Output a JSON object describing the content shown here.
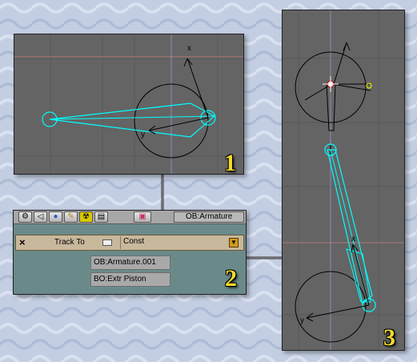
{
  "viewport1": {
    "label": "1",
    "axis_x": "x",
    "axis_y": "y"
  },
  "viewport3": {
    "label": "3",
    "axis_x": "x",
    "axis_y": "y"
  },
  "constraint_panel": {
    "label": "2",
    "object_name": "OB:Armature",
    "constraint_type": "Track To",
    "constraint_name": "Const",
    "close_glyph": "×",
    "target_object": "OB:Armature.001",
    "target_bone": "BO:Extr Piston",
    "tab_icons": [
      "gear-icon",
      "speaker-icon",
      "globe-icon",
      "pencil-icon",
      "radiation-icon",
      "grid-icon",
      "image-icon"
    ]
  },
  "colors": {
    "bone": "#00ffff",
    "viewport_bg": "#646464",
    "panel_bg": "#6a8a8a",
    "constraint_row": "#c8b89c",
    "number_label": "#f2da2c"
  }
}
